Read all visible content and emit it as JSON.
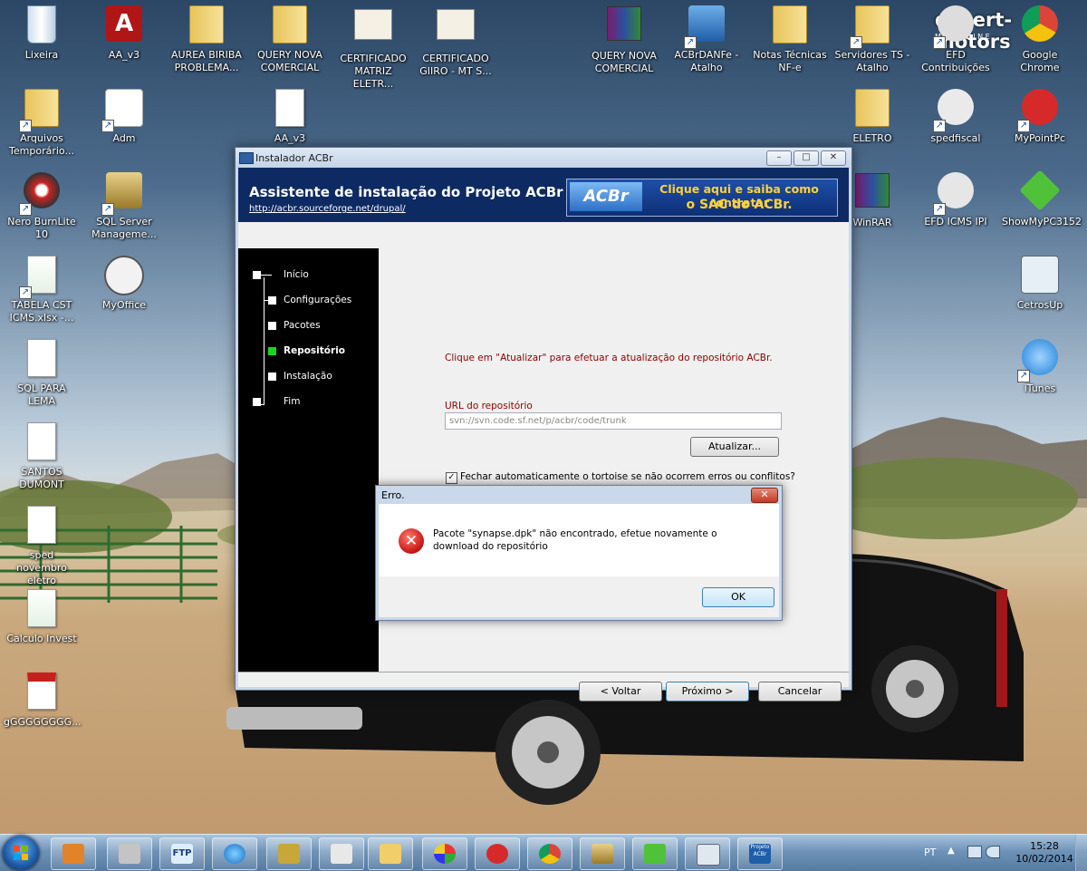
{
  "desktop": {
    "icons": [
      {
        "label": "Lixeira"
      },
      {
        "label": "AA_v3"
      },
      {
        "label": "AUREA BIRIBA PROBLEMA..."
      },
      {
        "label": "QUERY NOVA COMERCIAL"
      },
      {
        "label": "CERTIFICADO MATRIZ ELETR..."
      },
      {
        "label": "CERTIFICADO GIIRO - MT S..."
      },
      {
        "label": "QUERY NOVA COMERCIAL"
      },
      {
        "label": "ACBrDANFe - Atalho"
      },
      {
        "label": "Notas Técnicas NF-e"
      },
      {
        "label": "Servidores TS - Atalho"
      },
      {
        "label": "EFD Contribuições"
      },
      {
        "label": "Google Chrome"
      },
      {
        "label": "Arquivos Temporário..."
      },
      {
        "label": "Adm"
      },
      {
        "label": "AA_v3"
      },
      {
        "label": "ELETRO"
      },
      {
        "label": "spedfiscal"
      },
      {
        "label": "MyPointPc"
      },
      {
        "label": "Nero BurnLite 10"
      },
      {
        "label": "SQL Server Manageme..."
      },
      {
        "label": "WinRAR"
      },
      {
        "label": "EFD ICMS IPI"
      },
      {
        "label": "ShowMyPC3152"
      },
      {
        "label": "TABELA CST ICMS.xlsx -..."
      },
      {
        "label": "MyOffice"
      },
      {
        "label": "CetrosUp"
      },
      {
        "label": "SQL PARA LEMA"
      },
      {
        "label": "iTunes"
      },
      {
        "label": "SANTOS DUMONT"
      },
      {
        "label": "sped novembro eletro"
      },
      {
        "label": "Calculo Invest"
      },
      {
        "label": "gGGGGGGGG..."
      }
    ],
    "watermark": "desert-motors",
    "watermark_sub": "M A G A Z I N E"
  },
  "installer": {
    "window_title": "Instalador ACBr",
    "min_glyph": "–",
    "max_glyph": "□",
    "close_glyph": "✕",
    "heading": "Assistente de instalação do Projeto ACBr",
    "link": "http://acbr.sourceforge.net/drupal/",
    "sac_logo": "ACBr",
    "sac_line1": "Clique aqui e saiba como contratar",
    "sac_line2": "o SAC do ACBr.",
    "steps": [
      "Início",
      "Configurações",
      "Pacotes",
      "Repositório",
      "Instalação",
      "Fim"
    ],
    "active_step": "Repositório",
    "message": "Clique em \"Atualizar\" para efetuar a atualização do repositório ACBr.",
    "url_label": "URL do  repositório",
    "url_value": "svn://svn.code.sf.net/p/acbr/code/trunk",
    "update_button": "Atualizar...",
    "checkbox_checked": true,
    "checkbox_label": "Fechar automaticamente o tortoise se não ocorrem erros ou conflitos?",
    "back_button": "< Voltar",
    "next_button": "Próximo >",
    "cancel_button": "Cancelar"
  },
  "dialog": {
    "title": "Erro.",
    "close_glyph": "✕",
    "error_glyph": "✕",
    "message": "Pacote \"synapse.dpk\" não encontrado, efetue novamente o download do repositório",
    "ok_button": "OK"
  },
  "taskbar": {
    "items": [
      "media-player-icon",
      "folder-config-icon",
      "ftp-icon",
      "internet-explorer-icon",
      "7zip-icon",
      "tool-icon",
      "explorer-icon",
      "paint-icon",
      "mypointpc-icon",
      "chrome-icon",
      "sql-icon",
      "showmypc-icon",
      "calculator-icon",
      "projeto-acbr-icon"
    ],
    "ftp_label": "FTP",
    "acbr_label": "Projeto ACBr",
    "language": "PT",
    "time": "15:28",
    "date": "10/02/2014"
  },
  "colors": {
    "banner": "#0e2a63",
    "sidebar": "#000000",
    "active_step": "#1ed31e",
    "message_text": "#8b0000"
  }
}
